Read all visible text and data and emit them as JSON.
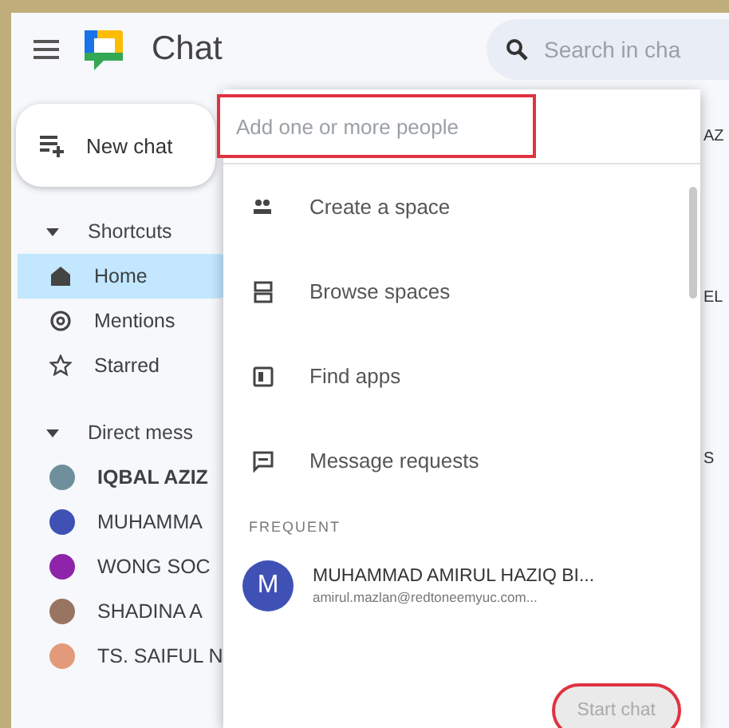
{
  "app": {
    "title": "Chat",
    "search_placeholder": "Search in cha"
  },
  "new_chat": {
    "label": "New chat"
  },
  "sidebar": {
    "sections": [
      {
        "label": "Shortcuts",
        "expanded": true,
        "items": [
          {
            "kind": "home",
            "label": "Home",
            "selected": true,
            "unread": false
          },
          {
            "kind": "mention",
            "label": "Mentions",
            "selected": false,
            "unread": false
          },
          {
            "kind": "star",
            "label": "Starred",
            "selected": false,
            "unread": false
          }
        ]
      },
      {
        "label": "Direct mess",
        "expanded": true,
        "items": [
          {
            "kind": "person",
            "label": "IQBAL AZIZ",
            "selected": false,
            "unread": true,
            "color": "#6f8f9c"
          },
          {
            "kind": "person",
            "label": "MUHAMMA",
            "selected": false,
            "unread": false,
            "color": "#3f51b5"
          },
          {
            "kind": "person",
            "label": "WONG SOC",
            "selected": false,
            "unread": false,
            "color": "#8e24aa"
          },
          {
            "kind": "person",
            "label": "SHADINA A",
            "selected": false,
            "unread": false,
            "color": "#9a7462"
          },
          {
            "kind": "person",
            "label": "TS. SAIFUL N",
            "selected": false,
            "unread": false,
            "color": "#e39a7a"
          }
        ]
      }
    ]
  },
  "dialog": {
    "input": {
      "placeholder": "Add one or more people",
      "highlighted": true
    },
    "actions": [
      {
        "kind": "create",
        "label": "Create a space"
      },
      {
        "kind": "browse",
        "label": "Browse spaces"
      },
      {
        "kind": "apps",
        "label": "Find apps"
      },
      {
        "kind": "requests",
        "label": "Message requests"
      }
    ],
    "frequent_heading": "FREQUENT",
    "frequent": [
      {
        "initial": "M",
        "name": "MUHAMMAD AMIRUL HAZIQ BI...",
        "email": "amirul.mazlan@redtoneemyuc.com...",
        "color": "#3f51b5"
      }
    ],
    "start_button": {
      "label": "Start chat",
      "disabled": true,
      "highlighted": true
    }
  },
  "background_fragments": [
    "AZ",
    "EL",
    "S"
  ]
}
